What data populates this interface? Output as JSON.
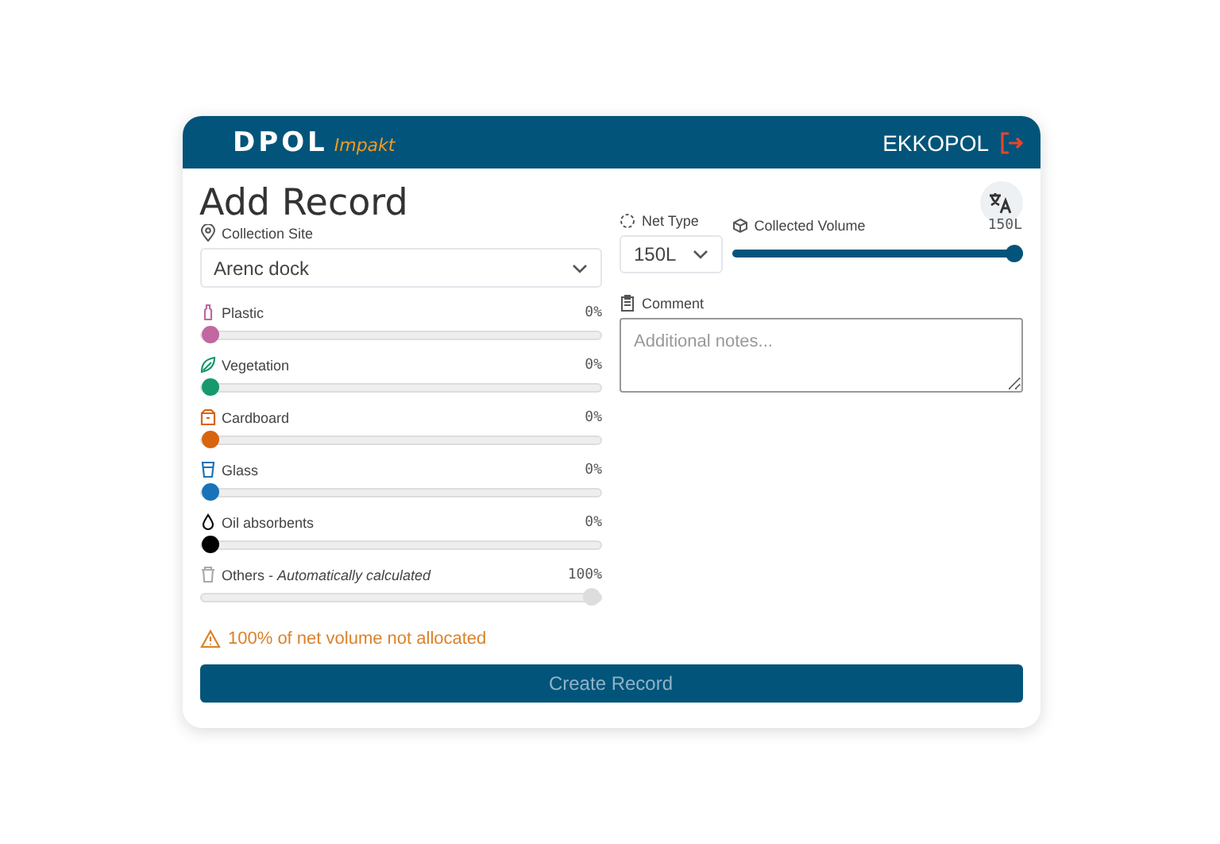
{
  "header": {
    "logo": "DPOL",
    "logo_sub": "Impakt",
    "user": "EKKOPOL"
  },
  "title": "Add Record",
  "site": {
    "label": "Collection Site",
    "value": "Arenc dock"
  },
  "net_type": {
    "label": "Net Type",
    "value": "150L"
  },
  "volume": {
    "label": "Collected Volume",
    "reading": "150L",
    "level": 1
  },
  "comment": {
    "label": "Comment",
    "placeholder": "Additional notes..."
  },
  "materials": [
    {
      "kind": "slider",
      "label": "Plastic",
      "reading": "0%",
      "level": 0,
      "color": "#c2679f"
    },
    {
      "kind": "slider",
      "label": "Vegetation",
      "reading": "0%",
      "level": 0,
      "color": "#16996b"
    },
    {
      "kind": "slider",
      "label": "Cardboard",
      "reading": "0%",
      "level": 0,
      "color": "#d86410"
    },
    {
      "kind": "slider",
      "label": "Glass",
      "reading": "0%",
      "level": 0,
      "color": "#1a73b8"
    },
    {
      "kind": "slider",
      "label": "Oil absorbents",
      "reading": "0%",
      "level": 0,
      "color": "#000000"
    },
    {
      "kind": "auto",
      "label": "Others - *Automatically calculated*",
      "reading": "100%",
      "level": 1,
      "color": "#dddddd"
    }
  ],
  "warning": "100% of net volume not allocated",
  "submit": {
    "label": "Create Record",
    "disabled": true
  }
}
